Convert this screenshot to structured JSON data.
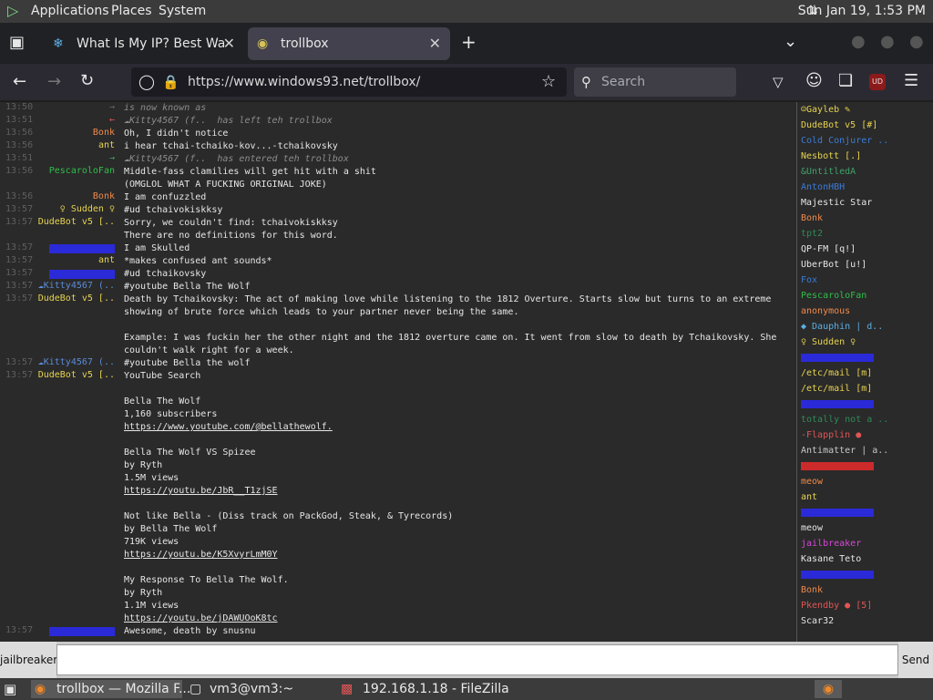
{
  "topbar": {
    "menus": [
      "Applications",
      "Places",
      "System"
    ],
    "clock": "Sun Jan 19,  1:53 PM"
  },
  "browser": {
    "tabs": [
      {
        "title": "What Is My IP? Best Way To"
      },
      {
        "title": "trollbox"
      }
    ],
    "url": "https://www.windows93.net/trollbox/",
    "search_placeholder": "Search",
    "ublock_label": "UD"
  },
  "messages": [
    {
      "time": "13:50",
      "nick": "→",
      "nick_color": "#6a6a6a",
      "text": "is now known as",
      "sys": true
    },
    {
      "time": "13:51",
      "nick": "←",
      "nick_color": "#e05555",
      "text": "☁Kitty4567 (f..  has left teh trollbox",
      "sys": true
    },
    {
      "time": "13:56",
      "nick": "Bonk",
      "nick_color": "#f08a4b",
      "text": "Oh, I didn't notice"
    },
    {
      "time": "13:56",
      "nick": "ant",
      "nick_color": "#e7d34f",
      "text": "i hear tchai-tchaiko-kov...-tchaikovsky"
    },
    {
      "time": "13:51",
      "nick": "→",
      "nick_color": "#3ea36a",
      "text": "☁Kitty4567 (f..  has entered teh trollbox",
      "sys": true
    },
    {
      "time": "13:56",
      "nick": "PescaroloFan",
      "nick_color": "#2fbf4a",
      "text": "Middle-fass clamilies will get hit with a shit\n(OMGLOL WHAT A FUCKING ORIGINAL JOKE)"
    },
    {
      "time": "13:56",
      "nick": "Bonk",
      "nick_color": "#f08a4b",
      "text": "I am confuzzled"
    },
    {
      "time": "13:57",
      "nick": "♀ Sudden ♀",
      "nick_color": "#e7d34f",
      "text": "#ud tchaivokiskksy"
    },
    {
      "time": "13:57",
      "nick": "DudeBot v5 [..",
      "nick_color": "#e7d34f",
      "text": "Sorry, we couldn't find: tchaivokiskksy\nThere are no definitions for this word."
    },
    {
      "time": "13:57",
      "nick": "",
      "nick_color": "#2a2ad8",
      "text": "I am Skulled"
    },
    {
      "time": "13:57",
      "nick": "ant",
      "nick_color": "#e7d34f",
      "text": "*makes confused ant sounds*"
    },
    {
      "time": "13:57",
      "nick": "",
      "nick_color": "#2a2ad8",
      "text": "#ud tchaikovsky"
    },
    {
      "time": "13:57",
      "nick": "☁Kitty4567 (..",
      "nick_color": "#5b8bd6",
      "text": "#youtube Bella The Wolf"
    },
    {
      "time": "13:57",
      "nick": "DudeBot v5 [..",
      "nick_color": "#e7d34f",
      "text": "Death by Tchaikovsky: The act of making love while listening to the 1812 Overture. Starts slow but turns to an extreme showing of brute force which leads to your partner never being the same.\n\nExample: I was fuckin her the other night and the 1812 overture came on. It went from slow to death by Tchaikovsky. She couldn't walk right for a week."
    },
    {
      "time": "13:57",
      "nick": "☁Kitty4567 (..",
      "nick_color": "#5b8bd6",
      "text": "#youtube Bella the wolf"
    },
    {
      "time": "13:57",
      "nick": "DudeBot v5 [..",
      "nick_color": "#e7d34f",
      "text": "YouTube Search\n\nBella The Wolf\n1,160 subscribers\nhttps://www.youtube.com/@bellathewolf.\n\nBella The Wolf VS Spizee\nby Ryth\n1.5M views\nhttps://youtu.be/JbR__T1zjSE\n\nNot like Bella - (Diss track on PackGod, Steak, & Tyrecords)\nby Bella The Wolf\n719K views\nhttps://youtu.be/K5XvyrLmM0Y\n\nMy Response To Bella The Wolf.\nby Ryth\n1.1M views\nhttps://youtu.be/jDAWUOoK8tc"
    },
    {
      "time": "13:57",
      "nick": "",
      "nick_color": "#2a2ad8",
      "text": "Awesome, death by snusnu"
    }
  ],
  "users": [
    {
      "name": "☺Gayleb ✎",
      "color": "#e7d34f"
    },
    {
      "name": "DudeBot v5 [#]",
      "color": "#e7d34f"
    },
    {
      "name": "Cold Conjurer ..",
      "color": "#3c7bd6"
    },
    {
      "name": "Nesbott [.]",
      "color": "#e7d34f"
    },
    {
      "name": "&UntitledA",
      "color": "#3ea36a"
    },
    {
      "name": "AntonHBH",
      "color": "#3c7bd6"
    },
    {
      "name": "Majestic Star",
      "color": "#e6e6e6"
    },
    {
      "name": "Bonk",
      "color": "#f08a4b"
    },
    {
      "name": "tpt2",
      "color": "#2e8b57"
    },
    {
      "name": "QP-FM [q!]",
      "color": "#e6e6e6"
    },
    {
      "name": "UberBot [u!]",
      "color": "#e6e6e6"
    },
    {
      "name": "Fox",
      "color": "#3c7bd6"
    },
    {
      "name": "PescaroloFan",
      "color": "#2fbf4a"
    },
    {
      "name": "anonymous",
      "color": "#f08a4b"
    },
    {
      "name": "◆ Dauphin | d..",
      "color": "#5bb0e6"
    },
    {
      "name": "♀ Sudden ♀",
      "color": "#e7d34f"
    },
    {
      "name": "",
      "color": "#2a2ad8"
    },
    {
      "name": "/etc/mail [m]",
      "color": "#e7d34f"
    },
    {
      "name": "/etc/mail [m]",
      "color": "#e7d34f"
    },
    {
      "name": "",
      "color": "#2a2ad8"
    },
    {
      "name": "totally not a ..",
      "color": "#2e8b57"
    },
    {
      "name": "-Flapplin ●",
      "color": "#e05555"
    },
    {
      "name": "Antimatter | a..",
      "color": "#c8c8c8"
    },
    {
      "name": "",
      "color": "#cc2b2b"
    },
    {
      "name": "meow",
      "color": "#f08a4b"
    },
    {
      "name": "ant",
      "color": "#e7d34f"
    },
    {
      "name": "",
      "color": "#2a2ad8"
    },
    {
      "name": "meow",
      "color": "#e6e6e6"
    },
    {
      "name": "jailbreaker",
      "color": "#d64ad6"
    },
    {
      "name": "Kasane Teto",
      "color": "#e6e6e6"
    },
    {
      "name": "",
      "color": "#2a2ad8"
    },
    {
      "name": "Bonk",
      "color": "#f08a4b"
    },
    {
      "name": "Pkendby ● [5]",
      "color": "#e05555"
    },
    {
      "name": "Scar32",
      "color": "#e6e6e6"
    }
  ],
  "chat_input": {
    "nick": "jailbreaker",
    "send_label": "Send",
    "value": ""
  },
  "taskbar": {
    "items": [
      "trollbox — Mozilla F...",
      "vm3@vm3:~",
      "192.168.1.18 - FileZilla"
    ]
  }
}
